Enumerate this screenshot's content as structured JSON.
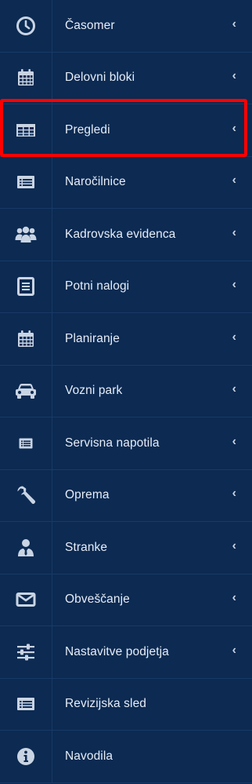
{
  "menu": {
    "items": [
      {
        "label": "Časomer",
        "icon": "clock-icon",
        "has_submenu": true
      },
      {
        "label": "Delovni bloki",
        "icon": "calendar-icon",
        "has_submenu": true
      },
      {
        "label": "Pregledi",
        "icon": "table-icon",
        "has_submenu": true
      },
      {
        "label": "Naročilnice",
        "icon": "list-card-icon",
        "has_submenu": true
      },
      {
        "label": "Kadrovska evidenca",
        "icon": "users-icon",
        "has_submenu": true
      },
      {
        "label": "Potni nalogi",
        "icon": "document-icon",
        "has_submenu": true
      },
      {
        "label": "Planiranje",
        "icon": "calendar-grid-icon",
        "has_submenu": true
      },
      {
        "label": "Vozni park",
        "icon": "car-icon",
        "has_submenu": true
      },
      {
        "label": "Servisna napotila",
        "icon": "small-list-icon",
        "has_submenu": true
      },
      {
        "label": "Oprema",
        "icon": "wrench-icon",
        "has_submenu": true
      },
      {
        "label": "Stranke",
        "icon": "person-tie-icon",
        "has_submenu": true
      },
      {
        "label": "Obveščanje",
        "icon": "envelope-icon",
        "has_submenu": true
      },
      {
        "label": "Nastavitve podjetja",
        "icon": "sliders-icon",
        "has_submenu": true
      },
      {
        "label": "Revizijska sled",
        "icon": "list-card-icon",
        "has_submenu": false
      },
      {
        "label": "Navodila",
        "icon": "info-icon",
        "has_submenu": false
      }
    ],
    "chevron_glyph": "‹",
    "highlighted_item": "Pregledi"
  },
  "colors": {
    "background": "#0c2a52",
    "divider": "#183a66",
    "text": "#e6edf6",
    "icon": "#c9d4e3",
    "highlight": "#ff0000"
  }
}
